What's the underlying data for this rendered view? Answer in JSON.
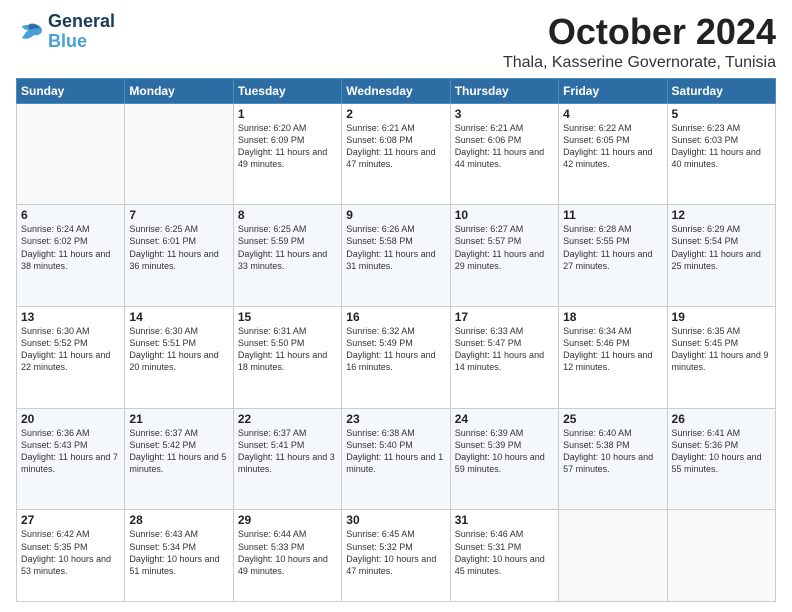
{
  "header": {
    "logo_line1": "General",
    "logo_line2": "Blue",
    "month": "October 2024",
    "location": "Thala, Kasserine Governorate, Tunisia"
  },
  "days_of_week": [
    "Sunday",
    "Monday",
    "Tuesday",
    "Wednesday",
    "Thursday",
    "Friday",
    "Saturday"
  ],
  "weeks": [
    [
      {
        "day": "",
        "sunrise": "",
        "sunset": "",
        "daylight": ""
      },
      {
        "day": "",
        "sunrise": "",
        "sunset": "",
        "daylight": ""
      },
      {
        "day": "1",
        "sunrise": "Sunrise: 6:20 AM",
        "sunset": "Sunset: 6:09 PM",
        "daylight": "Daylight: 11 hours and 49 minutes."
      },
      {
        "day": "2",
        "sunrise": "Sunrise: 6:21 AM",
        "sunset": "Sunset: 6:08 PM",
        "daylight": "Daylight: 11 hours and 47 minutes."
      },
      {
        "day": "3",
        "sunrise": "Sunrise: 6:21 AM",
        "sunset": "Sunset: 6:06 PM",
        "daylight": "Daylight: 11 hours and 44 minutes."
      },
      {
        "day": "4",
        "sunrise": "Sunrise: 6:22 AM",
        "sunset": "Sunset: 6:05 PM",
        "daylight": "Daylight: 11 hours and 42 minutes."
      },
      {
        "day": "5",
        "sunrise": "Sunrise: 6:23 AM",
        "sunset": "Sunset: 6:03 PM",
        "daylight": "Daylight: 11 hours and 40 minutes."
      }
    ],
    [
      {
        "day": "6",
        "sunrise": "Sunrise: 6:24 AM",
        "sunset": "Sunset: 6:02 PM",
        "daylight": "Daylight: 11 hours and 38 minutes."
      },
      {
        "day": "7",
        "sunrise": "Sunrise: 6:25 AM",
        "sunset": "Sunset: 6:01 PM",
        "daylight": "Daylight: 11 hours and 36 minutes."
      },
      {
        "day": "8",
        "sunrise": "Sunrise: 6:25 AM",
        "sunset": "Sunset: 5:59 PM",
        "daylight": "Daylight: 11 hours and 33 minutes."
      },
      {
        "day": "9",
        "sunrise": "Sunrise: 6:26 AM",
        "sunset": "Sunset: 5:58 PM",
        "daylight": "Daylight: 11 hours and 31 minutes."
      },
      {
        "day": "10",
        "sunrise": "Sunrise: 6:27 AM",
        "sunset": "Sunset: 5:57 PM",
        "daylight": "Daylight: 11 hours and 29 minutes."
      },
      {
        "day": "11",
        "sunrise": "Sunrise: 6:28 AM",
        "sunset": "Sunset: 5:55 PM",
        "daylight": "Daylight: 11 hours and 27 minutes."
      },
      {
        "day": "12",
        "sunrise": "Sunrise: 6:29 AM",
        "sunset": "Sunset: 5:54 PM",
        "daylight": "Daylight: 11 hours and 25 minutes."
      }
    ],
    [
      {
        "day": "13",
        "sunrise": "Sunrise: 6:30 AM",
        "sunset": "Sunset: 5:52 PM",
        "daylight": "Daylight: 11 hours and 22 minutes."
      },
      {
        "day": "14",
        "sunrise": "Sunrise: 6:30 AM",
        "sunset": "Sunset: 5:51 PM",
        "daylight": "Daylight: 11 hours and 20 minutes."
      },
      {
        "day": "15",
        "sunrise": "Sunrise: 6:31 AM",
        "sunset": "Sunset: 5:50 PM",
        "daylight": "Daylight: 11 hours and 18 minutes."
      },
      {
        "day": "16",
        "sunrise": "Sunrise: 6:32 AM",
        "sunset": "Sunset: 5:49 PM",
        "daylight": "Daylight: 11 hours and 16 minutes."
      },
      {
        "day": "17",
        "sunrise": "Sunrise: 6:33 AM",
        "sunset": "Sunset: 5:47 PM",
        "daylight": "Daylight: 11 hours and 14 minutes."
      },
      {
        "day": "18",
        "sunrise": "Sunrise: 6:34 AM",
        "sunset": "Sunset: 5:46 PM",
        "daylight": "Daylight: 11 hours and 12 minutes."
      },
      {
        "day": "19",
        "sunrise": "Sunrise: 6:35 AM",
        "sunset": "Sunset: 5:45 PM",
        "daylight": "Daylight: 11 hours and 9 minutes."
      }
    ],
    [
      {
        "day": "20",
        "sunrise": "Sunrise: 6:36 AM",
        "sunset": "Sunset: 5:43 PM",
        "daylight": "Daylight: 11 hours and 7 minutes."
      },
      {
        "day": "21",
        "sunrise": "Sunrise: 6:37 AM",
        "sunset": "Sunset: 5:42 PM",
        "daylight": "Daylight: 11 hours and 5 minutes."
      },
      {
        "day": "22",
        "sunrise": "Sunrise: 6:37 AM",
        "sunset": "Sunset: 5:41 PM",
        "daylight": "Daylight: 11 hours and 3 minutes."
      },
      {
        "day": "23",
        "sunrise": "Sunrise: 6:38 AM",
        "sunset": "Sunset: 5:40 PM",
        "daylight": "Daylight: 11 hours and 1 minute."
      },
      {
        "day": "24",
        "sunrise": "Sunrise: 6:39 AM",
        "sunset": "Sunset: 5:39 PM",
        "daylight": "Daylight: 10 hours and 59 minutes."
      },
      {
        "day": "25",
        "sunrise": "Sunrise: 6:40 AM",
        "sunset": "Sunset: 5:38 PM",
        "daylight": "Daylight: 10 hours and 57 minutes."
      },
      {
        "day": "26",
        "sunrise": "Sunrise: 6:41 AM",
        "sunset": "Sunset: 5:36 PM",
        "daylight": "Daylight: 10 hours and 55 minutes."
      }
    ],
    [
      {
        "day": "27",
        "sunrise": "Sunrise: 6:42 AM",
        "sunset": "Sunset: 5:35 PM",
        "daylight": "Daylight: 10 hours and 53 minutes."
      },
      {
        "day": "28",
        "sunrise": "Sunrise: 6:43 AM",
        "sunset": "Sunset: 5:34 PM",
        "daylight": "Daylight: 10 hours and 51 minutes."
      },
      {
        "day": "29",
        "sunrise": "Sunrise: 6:44 AM",
        "sunset": "Sunset: 5:33 PM",
        "daylight": "Daylight: 10 hours and 49 minutes."
      },
      {
        "day": "30",
        "sunrise": "Sunrise: 6:45 AM",
        "sunset": "Sunset: 5:32 PM",
        "daylight": "Daylight: 10 hours and 47 minutes."
      },
      {
        "day": "31",
        "sunrise": "Sunrise: 6:46 AM",
        "sunset": "Sunset: 5:31 PM",
        "daylight": "Daylight: 10 hours and 45 minutes."
      },
      {
        "day": "",
        "sunrise": "",
        "sunset": "",
        "daylight": ""
      },
      {
        "day": "",
        "sunrise": "",
        "sunset": "",
        "daylight": ""
      }
    ]
  ]
}
